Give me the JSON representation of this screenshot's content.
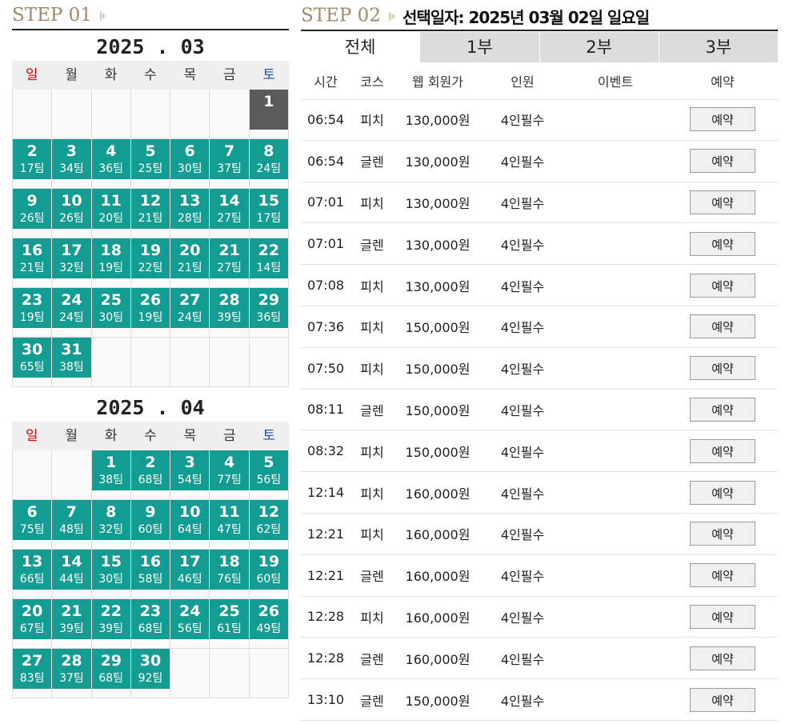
{
  "step1": {
    "label": "STEP 01"
  },
  "step2": {
    "label": "STEP 02",
    "selected_date": "선택일자: 2025년 03월 02일 일요일"
  },
  "weekdays": [
    "일",
    "월",
    "화",
    "수",
    "목",
    "금",
    "토"
  ],
  "calendars": [
    {
      "title": "2025 . 03",
      "offset": 6,
      "cells": [
        {
          "day": "1",
          "teams": "",
          "state": "today"
        },
        {
          "day": "2",
          "teams": "17팀",
          "state": "avail"
        },
        {
          "day": "3",
          "teams": "34팀",
          "state": "avail"
        },
        {
          "day": "4",
          "teams": "36팀",
          "state": "avail"
        },
        {
          "day": "5",
          "teams": "25팀",
          "state": "avail"
        },
        {
          "day": "6",
          "teams": "30팀",
          "state": "avail"
        },
        {
          "day": "7",
          "teams": "37팀",
          "state": "avail"
        },
        {
          "day": "8",
          "teams": "24팀",
          "state": "avail"
        },
        {
          "day": "9",
          "teams": "26팀",
          "state": "avail"
        },
        {
          "day": "10",
          "teams": "26팀",
          "state": "avail"
        },
        {
          "day": "11",
          "teams": "20팀",
          "state": "avail"
        },
        {
          "day": "12",
          "teams": "21팀",
          "state": "avail"
        },
        {
          "day": "13",
          "teams": "28팀",
          "state": "avail"
        },
        {
          "day": "14",
          "teams": "27팀",
          "state": "avail"
        },
        {
          "day": "15",
          "teams": "17팀",
          "state": "avail"
        },
        {
          "day": "16",
          "teams": "21팀",
          "state": "avail"
        },
        {
          "day": "17",
          "teams": "32팀",
          "state": "avail"
        },
        {
          "day": "18",
          "teams": "19팀",
          "state": "avail"
        },
        {
          "day": "19",
          "teams": "22팀",
          "state": "avail"
        },
        {
          "day": "20",
          "teams": "21팀",
          "state": "avail"
        },
        {
          "day": "21",
          "teams": "27팀",
          "state": "avail"
        },
        {
          "day": "22",
          "teams": "14팀",
          "state": "avail"
        },
        {
          "day": "23",
          "teams": "19팀",
          "state": "avail"
        },
        {
          "day": "24",
          "teams": "24팀",
          "state": "avail"
        },
        {
          "day": "25",
          "teams": "30팀",
          "state": "avail"
        },
        {
          "day": "26",
          "teams": "19팀",
          "state": "avail"
        },
        {
          "day": "27",
          "teams": "24팀",
          "state": "avail"
        },
        {
          "day": "28",
          "teams": "39팀",
          "state": "avail"
        },
        {
          "day": "29",
          "teams": "36팀",
          "state": "avail"
        },
        {
          "day": "30",
          "teams": "65팀",
          "state": "avail"
        },
        {
          "day": "31",
          "teams": "38팀",
          "state": "avail"
        }
      ]
    },
    {
      "title": "2025 . 04",
      "offset": 2,
      "cells": [
        {
          "day": "1",
          "teams": "38팀",
          "state": "avail"
        },
        {
          "day": "2",
          "teams": "68팀",
          "state": "avail"
        },
        {
          "day": "3",
          "teams": "54팀",
          "state": "avail"
        },
        {
          "day": "4",
          "teams": "77팀",
          "state": "avail"
        },
        {
          "day": "5",
          "teams": "56팀",
          "state": "avail"
        },
        {
          "day": "6",
          "teams": "75팀",
          "state": "avail"
        },
        {
          "day": "7",
          "teams": "48팀",
          "state": "avail"
        },
        {
          "day": "8",
          "teams": "32팀",
          "state": "avail"
        },
        {
          "day": "9",
          "teams": "60팀",
          "state": "avail"
        },
        {
          "day": "10",
          "teams": "64팀",
          "state": "avail"
        },
        {
          "day": "11",
          "teams": "47팀",
          "state": "avail"
        },
        {
          "day": "12",
          "teams": "62팀",
          "state": "avail"
        },
        {
          "day": "13",
          "teams": "66팀",
          "state": "avail"
        },
        {
          "day": "14",
          "teams": "44팀",
          "state": "avail"
        },
        {
          "day": "15",
          "teams": "30팀",
          "state": "avail"
        },
        {
          "day": "16",
          "teams": "58팀",
          "state": "avail"
        },
        {
          "day": "17",
          "teams": "46팀",
          "state": "avail"
        },
        {
          "day": "18",
          "teams": "76팀",
          "state": "avail"
        },
        {
          "day": "19",
          "teams": "60팀",
          "state": "avail"
        },
        {
          "day": "20",
          "teams": "67팀",
          "state": "avail"
        },
        {
          "day": "21",
          "teams": "39팀",
          "state": "avail"
        },
        {
          "day": "22",
          "teams": "39팀",
          "state": "avail"
        },
        {
          "day": "23",
          "teams": "68팀",
          "state": "avail"
        },
        {
          "day": "24",
          "teams": "56팀",
          "state": "avail"
        },
        {
          "day": "25",
          "teams": "61팀",
          "state": "avail"
        },
        {
          "day": "26",
          "teams": "49팀",
          "state": "avail"
        },
        {
          "day": "27",
          "teams": "83팀",
          "state": "avail"
        },
        {
          "day": "28",
          "teams": "37팀",
          "state": "avail"
        },
        {
          "day": "29",
          "teams": "68팀",
          "state": "avail"
        },
        {
          "day": "30",
          "teams": "92팀",
          "state": "avail"
        }
      ]
    }
  ],
  "tabs": [
    "전체",
    "1부",
    "2부",
    "3부"
  ],
  "table_headers": {
    "time": "시간",
    "course": "코스",
    "price": "웹 회원가",
    "people": "인원",
    "event": "이벤트",
    "book": "예약"
  },
  "rows": [
    {
      "time": "06:54",
      "course": "피치",
      "price": "130,000원",
      "people": "4인필수",
      "event": "",
      "book": "예약"
    },
    {
      "time": "06:54",
      "course": "글렌",
      "price": "130,000원",
      "people": "4인필수",
      "event": "",
      "book": "예약"
    },
    {
      "time": "07:01",
      "course": "피치",
      "price": "130,000원",
      "people": "4인필수",
      "event": "",
      "book": "예약"
    },
    {
      "time": "07:01",
      "course": "글렌",
      "price": "130,000원",
      "people": "4인필수",
      "event": "",
      "book": "예약"
    },
    {
      "time": "07:08",
      "course": "피치",
      "price": "130,000원",
      "people": "4인필수",
      "event": "",
      "book": "예약"
    },
    {
      "time": "07:36",
      "course": "피치",
      "price": "150,000원",
      "people": "4인필수",
      "event": "",
      "book": "예약"
    },
    {
      "time": "07:50",
      "course": "피치",
      "price": "150,000원",
      "people": "4인필수",
      "event": "",
      "book": "예약"
    },
    {
      "time": "08:11",
      "course": "글렌",
      "price": "150,000원",
      "people": "4인필수",
      "event": "",
      "book": "예약"
    },
    {
      "time": "08:32",
      "course": "피치",
      "price": "150,000원",
      "people": "4인필수",
      "event": "",
      "book": "예약"
    },
    {
      "time": "12:14",
      "course": "피치",
      "price": "160,000원",
      "people": "4인필수",
      "event": "",
      "book": "예약"
    },
    {
      "time": "12:21",
      "course": "피치",
      "price": "160,000원",
      "people": "4인필수",
      "event": "",
      "book": "예약"
    },
    {
      "time": "12:21",
      "course": "글렌",
      "price": "160,000원",
      "people": "4인필수",
      "event": "",
      "book": "예약"
    },
    {
      "time": "12:28",
      "course": "피치",
      "price": "160,000원",
      "people": "4인필수",
      "event": "",
      "book": "예약"
    },
    {
      "time": "12:28",
      "course": "글렌",
      "price": "160,000원",
      "people": "4인필수",
      "event": "",
      "book": "예약"
    },
    {
      "time": "13:10",
      "course": "글렌",
      "price": "150,000원",
      "people": "4인필수",
      "event": "",
      "book": "예약"
    }
  ],
  "colors": {
    "available": "#139c91",
    "selected": "#5a5a5a",
    "sunday": "#d40000",
    "saturday": "#1b4fb0"
  }
}
